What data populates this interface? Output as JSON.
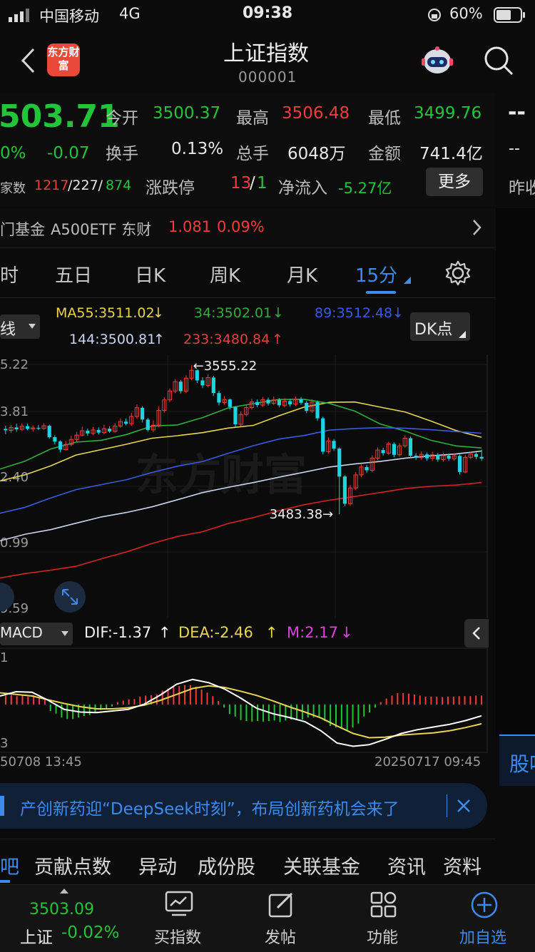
{
  "status_bar": {
    "carrier": "中国移动",
    "network": "4G",
    "time": "09:38",
    "battery": "60%"
  },
  "header": {
    "back_icon": "chevron-left-icon",
    "logo_text": "东方财富",
    "title": "上证指数",
    "code": "000001",
    "robot_icon": "robot-assistant-icon",
    "search_icon": "search-icon"
  },
  "quote": {
    "price": "503.71",
    "change_pct": "0%",
    "change": "-0.07",
    "open_label": "今开",
    "open": "3500.37",
    "high_label": "最高",
    "high": "3506.48",
    "low_label": "最低",
    "low": "3499.76",
    "turnover_label": "换手",
    "turnover": "0.13%",
    "volume_label": "总手",
    "volume": "6048万",
    "amount_label": "金额",
    "amount": "741.4亿",
    "count_label": "家数",
    "count_up": "1217",
    "count_flat": "/227/",
    "count_down": "874",
    "limit_label": "涨跌停",
    "limit_up": "13",
    "limit_sep": "/",
    "limit_down": "1",
    "netflow_label": "净流入",
    "netflow": "-5.27亿",
    "more_button": "更多",
    "right_dashes_1": "--",
    "right_dashes_2": "--",
    "right_prev": "昨收"
  },
  "fund_bar": {
    "label": "门基金",
    "fund_name": "A500ETF 东财",
    "fund_price": "1.081",
    "fund_change": "0.09%"
  },
  "period_tabs": [
    {
      "label": "时",
      "active": false
    },
    {
      "label": "五日",
      "active": false
    },
    {
      "label": "日K",
      "active": false
    },
    {
      "label": "周K",
      "active": false
    },
    {
      "label": "月K",
      "active": false
    },
    {
      "label": "15分",
      "active": true
    }
  ],
  "indicators": {
    "line_select": "线",
    "ma55": "MA55:3511.02",
    "ma34": "34:3502.01",
    "ma89": "89:3512.48",
    "ma144": "144:3500.81",
    "ma233": "233:3480.84",
    "dk_button": "DK点"
  },
  "colors": {
    "up": "#f23b3b",
    "down": "#22c43a",
    "accent": "#3b8bf0",
    "ma55": "#e8d44d",
    "ma34": "#2fae3b",
    "ma89": "#3a5be0",
    "ma144": "#c9d4ef",
    "ma233": "#d22222",
    "dif": "#ffffff",
    "dea": "#e8d44d",
    "m": "#e23ee3"
  },
  "chart_data": {
    "type": "candlestick",
    "y_ticks": [
      "5.22",
      "3.81",
      "2.40",
      "0.99",
      "9.59"
    ],
    "high_annotation": "3555.22",
    "low_annotation": "3483.38",
    "candles": [
      [
        3524.5,
        3523.8,
        3526.0,
        3522.0
      ],
      [
        3523.8,
        3525.2,
        3526.4,
        3522.6
      ],
      [
        3525.2,
        3524.3,
        3527.0,
        3523.1
      ],
      [
        3524.3,
        3525.8,
        3527.1,
        3523.5
      ],
      [
        3525.8,
        3524.5,
        3527.0,
        3523.8
      ],
      [
        3524.5,
        3525.0,
        3526.2,
        3523.3
      ],
      [
        3525.0,
        3524.7,
        3526.4,
        3523.9
      ],
      [
        3524.7,
        3526.0,
        3527.2,
        3524.1
      ],
      [
        3526.0,
        3520.5,
        3526.5,
        3519.8
      ],
      [
        3520.5,
        3518.4,
        3521.4,
        3517.0
      ],
      [
        3518.4,
        3514.5,
        3519.0,
        3513.2
      ],
      [
        3514.5,
        3517.0,
        3518.7,
        3514.0
      ],
      [
        3517.0,
        3519.4,
        3521.3,
        3516.1
      ],
      [
        3519.4,
        3521.5,
        3523.1,
        3518.4
      ],
      [
        3521.5,
        3523.6,
        3525.5,
        3520.9
      ],
      [
        3523.6,
        3522.3,
        3524.6,
        3521.1
      ],
      [
        3522.3,
        3524.0,
        3525.4,
        3521.5
      ],
      [
        3524.0,
        3522.7,
        3525.2,
        3521.8
      ],
      [
        3522.7,
        3524.6,
        3526.5,
        3522.0
      ],
      [
        3524.6,
        3523.3,
        3525.8,
        3522.6
      ],
      [
        3523.3,
        3525.9,
        3527.3,
        3522.7
      ],
      [
        3525.9,
        3528.0,
        3529.6,
        3525.0
      ],
      [
        3528.0,
        3527.0,
        3529.5,
        3526.2
      ],
      [
        3527.0,
        3530.5,
        3532.3,
        3526.0
      ],
      [
        3530.5,
        3534.7,
        3536.3,
        3529.6
      ],
      [
        3534.7,
        3529.0,
        3535.5,
        3527.6
      ],
      [
        3529.0,
        3524.0,
        3529.8,
        3523.1
      ],
      [
        3524.0,
        3526.3,
        3528.6,
        3522.9
      ],
      [
        3526.3,
        3533.4,
        3535.4,
        3525.2
      ],
      [
        3533.4,
        3538.5,
        3539.8,
        3532.3
      ],
      [
        3538.5,
        3542.8,
        3544.0,
        3537.4
      ],
      [
        3542.8,
        3547.3,
        3548.6,
        3541.7
      ],
      [
        3547.3,
        3542.7,
        3548.1,
        3541.5
      ],
      [
        3542.7,
        3549.0,
        3550.4,
        3541.8
      ],
      [
        3549.0,
        3552.8,
        3555.22,
        3548.0
      ],
      [
        3552.8,
        3547.9,
        3553.2,
        3546.7
      ],
      [
        3547.9,
        3545.5,
        3549.4,
        3544.2
      ],
      [
        3545.5,
        3549.3,
        3550.8,
        3544.6
      ],
      [
        3549.3,
        3541.8,
        3550.1,
        3540.4
      ],
      [
        3541.8,
        3537.2,
        3542.9,
        3535.8
      ],
      [
        3537.2,
        3538.7,
        3540.3,
        3536.1
      ],
      [
        3538.7,
        3535.1,
        3539.1,
        3533.9
      ],
      [
        3535.1,
        3526.7,
        3535.5,
        3525.4
      ],
      [
        3526.7,
        3531.5,
        3532.9,
        3525.8
      ],
      [
        3531.5,
        3534.8,
        3536.4,
        3530.6
      ],
      [
        3534.8,
        3537.5,
        3539.1,
        3533.8
      ],
      [
        3537.5,
        3536.0,
        3538.8,
        3535.0
      ],
      [
        3536.0,
        3538.6,
        3539.9,
        3535.1
      ],
      [
        3538.6,
        3536.8,
        3539.6,
        3535.8
      ],
      [
        3536.8,
        3538.5,
        3540.1,
        3535.9
      ],
      [
        3538.5,
        3535.9,
        3539.4,
        3534.9
      ],
      [
        3535.9,
        3537.9,
        3539.3,
        3535.0
      ],
      [
        3537.9,
        3536.4,
        3539.0,
        3535.3
      ],
      [
        3536.4,
        3538.8,
        3540.1,
        3535.6
      ],
      [
        3538.8,
        3537.1,
        3539.9,
        3536.2
      ],
      [
        3537.1,
        3533.2,
        3538.0,
        3532.1
      ],
      [
        3533.2,
        3537.4,
        3538.8,
        3532.3
      ],
      [
        3537.4,
        3529.6,
        3538.2,
        3528.4
      ],
      [
        3529.6,
        3513.5,
        3530.4,
        3512.2
      ],
      [
        3513.5,
        3518.7,
        3520.4,
        3512.6
      ],
      [
        3518.7,
        3515.0,
        3519.6,
        3513.9
      ],
      [
        3515.0,
        3501.5,
        3515.6,
        3483.38
      ],
      [
        3501.5,
        3488.4,
        3502.1,
        3487.2
      ],
      [
        3488.4,
        3496.0,
        3497.4,
        3487.5
      ],
      [
        3496.0,
        3502.3,
        3503.7,
        3495.1
      ],
      [
        3502.3,
        3506.1,
        3507.4,
        3501.2
      ],
      [
        3506.1,
        3504.5,
        3507.2,
        3503.4
      ],
      [
        3504.5,
        3510.4,
        3511.8,
        3503.6
      ],
      [
        3510.4,
        3514.3,
        3515.6,
        3509.5
      ],
      [
        3514.3,
        3512.8,
        3515.4,
        3511.6
      ],
      [
        3512.8,
        3517.2,
        3518.4,
        3511.9
      ],
      [
        3517.2,
        3512.0,
        3518.0,
        3510.8
      ],
      [
        3512.0,
        3516.3,
        3517.6,
        3511.1
      ],
      [
        3516.3,
        3520.0,
        3521.4,
        3515.4
      ],
      [
        3520.0,
        3511.6,
        3520.8,
        3510.4
      ],
      [
        3511.6,
        3510.6,
        3512.8,
        3509.5
      ],
      [
        3510.6,
        3512.2,
        3513.7,
        3509.6
      ],
      [
        3512.2,
        3510.3,
        3513.1,
        3509.1
      ],
      [
        3510.3,
        3512.0,
        3513.4,
        3509.2
      ],
      [
        3512.0,
        3509.7,
        3512.9,
        3508.6
      ],
      [
        3509.7,
        3511.6,
        3513.0,
        3508.6
      ],
      [
        3511.6,
        3510.1,
        3512.5,
        3509.0
      ],
      [
        3510.1,
        3511.5,
        3512.7,
        3509.2
      ],
      [
        3511.5,
        3503.71,
        3512.1,
        3502.5
      ],
      [
        3503.71,
        3510.8,
        3512.0,
        3503.0
      ],
      [
        3510.8,
        3512.4,
        3513.5,
        3509.8
      ],
      [
        3512.4,
        3511.0,
        3513.2,
        3509.9
      ],
      [
        3511.0,
        3510.2,
        3514.5,
        3509.1
      ]
    ],
    "ma_lines": [
      {
        "name": "MA55",
        "values": [
          3499.4,
          3502.4,
          3506.7,
          3511.9,
          3514.5,
          3517.1,
          3520.0,
          3521.2,
          3522.7,
          3524.9,
          3526.2,
          3530.8,
          3535.0,
          3537.3,
          3537.5,
          3535.0,
          3532.6,
          3528.3,
          3523.7,
          3520.5
        ]
      },
      {
        "name": "34",
        "values": [
          3505.1,
          3509.0,
          3514.8,
          3518.1,
          3519.0,
          3521.8,
          3525.9,
          3526.4,
          3530.0,
          3534.6,
          3536.7,
          3538.7,
          3538.8,
          3536.8,
          3533.1,
          3526.9,
          3523.4,
          3519.0,
          3516.3,
          3515.3
        ]
      },
      {
        "name": "89",
        "values": [
          3483.8,
          3486.7,
          3491.2,
          3495.2,
          3497.6,
          3500.0,
          3503.5,
          3506.5,
          3508.8,
          3512.7,
          3516.4,
          3519.6,
          3521.3,
          3523.9,
          3524.7,
          3525.1,
          3524.8,
          3524.1,
          3523.2,
          3522.4
        ]
      },
      {
        "name": "144",
        "values": [
          3470.5,
          3473.7,
          3475.9,
          3479.0,
          3482.0,
          3484.2,
          3486.9,
          3490.3,
          3493.8,
          3496.3,
          3498.6,
          3501.2,
          3503.6,
          3506.1,
          3507.6,
          3508.8,
          3510.4,
          3511.5,
          3512.4,
          3513.8
        ]
      },
      {
        "name": "233",
        "values": [
          3452.6,
          3454.7,
          3456.3,
          3458.2,
          3461.8,
          3465.2,
          3469.2,
          3472.6,
          3474.9,
          3478.8,
          3481.7,
          3485.0,
          3487.9,
          3490.1,
          3491.9,
          3493.8,
          3495.7,
          3496.8,
          3497.4,
          3498.6
        ]
      }
    ],
    "macd": {
      "label": "MACD",
      "dif_label": "DIF:-1.37",
      "dea_label": "DEA:-2.46",
      "m_label": "M:2.17",
      "top_tick": "1",
      "bottom_tick": "3",
      "hist": [
        1.8,
        1.9,
        1.7,
        1.8,
        1.6,
        1.9,
        1.4,
        1.3,
        -1.3,
        -1.8,
        -2.6,
        -2.9,
        -2.9,
        -2.6,
        -2.3,
        -2.1,
        -1.5,
        -1.1,
        -0.7,
        -0.4,
        0.5,
        0.8,
        1.0,
        1.1,
        1.6,
        1.8,
        1.9,
        2.0,
        2.8,
        3.2,
        3.5,
        3.7,
        3.9,
        3.9,
        3.6,
        3.0,
        2.4,
        1.7,
        0.7,
        -0.6,
        -1.9,
        -2.4,
        -3.1,
        -3.3,
        -3.4,
        -3.3,
        -3.4,
        -3.3,
        -3.2,
        -3.5,
        -3.2,
        -3.0,
        -3.1,
        -3.0,
        -2.6,
        -2.6,
        -2.5,
        -3.3,
        -4.3,
        -4.6,
        -4.9,
        -5.1,
        -4.6,
        -3.8,
        -2.4,
        -1.6,
        -0.6,
        0.5,
        1.2,
        1.8,
        2.3,
        2.3,
        2.2,
        2.0,
        1.8,
        1.6,
        1.6,
        1.6,
        1.5,
        1.6,
        1.6,
        1.7,
        1.7,
        1.7,
        1.8,
        1.8
      ],
      "dif": [
        1.6,
        2.4,
        2.3,
        0.8,
        -0.9,
        -1.4,
        -1.5,
        -1.2,
        -0.9,
        0.1,
        1.8,
        3.8,
        4.7,
        4.1,
        2.9,
        1.2,
        -0.7,
        -1.7,
        -2.4,
        -3.2,
        -4.9,
        -7.2,
        -7.8,
        -7.5,
        -6.5,
        -5.4,
        -4.7,
        -4.2,
        -3.7,
        -3.0,
        -2.1
      ],
      "dea": [
        2.2,
        1.9,
        1.6,
        0.9,
        0.2,
        -0.4,
        -0.8,
        -0.8,
        -0.6,
        -0.1,
        0.8,
        1.9,
        3.0,
        3.5,
        3.2,
        2.5,
        1.7,
        0.7,
        -0.4,
        -1.4,
        -2.5,
        -4.0,
        -5.4,
        -6.2,
        -6.1,
        -5.7,
        -5.5,
        -5.3,
        -4.9,
        -4.3,
        -3.6
      ],
      "start_label": "50708 13:45",
      "end_label": "20250717 09:45"
    }
  },
  "news_bar": {
    "text": "产创新药迎“DeepSeek时刻”，布局创新药机会来了",
    "close_icon": "close-icon"
  },
  "side_tab": "股吧",
  "sub_tabs": [
    "吧",
    "贡献点数",
    "异动",
    "成份股",
    "关联基金",
    "资讯",
    "资料"
  ],
  "bottom_nav": {
    "index_price": "3503.09",
    "index_name": "上证",
    "index_change": "-0.02%",
    "items": [
      {
        "label": "买指数",
        "icon": "chart-screen-icon",
        "active": false
      },
      {
        "label": "发帖",
        "icon": "edit-post-icon",
        "active": false
      },
      {
        "label": "功能",
        "icon": "grid-apps-icon",
        "active": false
      },
      {
        "label": "加自选",
        "icon": "plus-circle-icon",
        "active": true
      }
    ]
  }
}
